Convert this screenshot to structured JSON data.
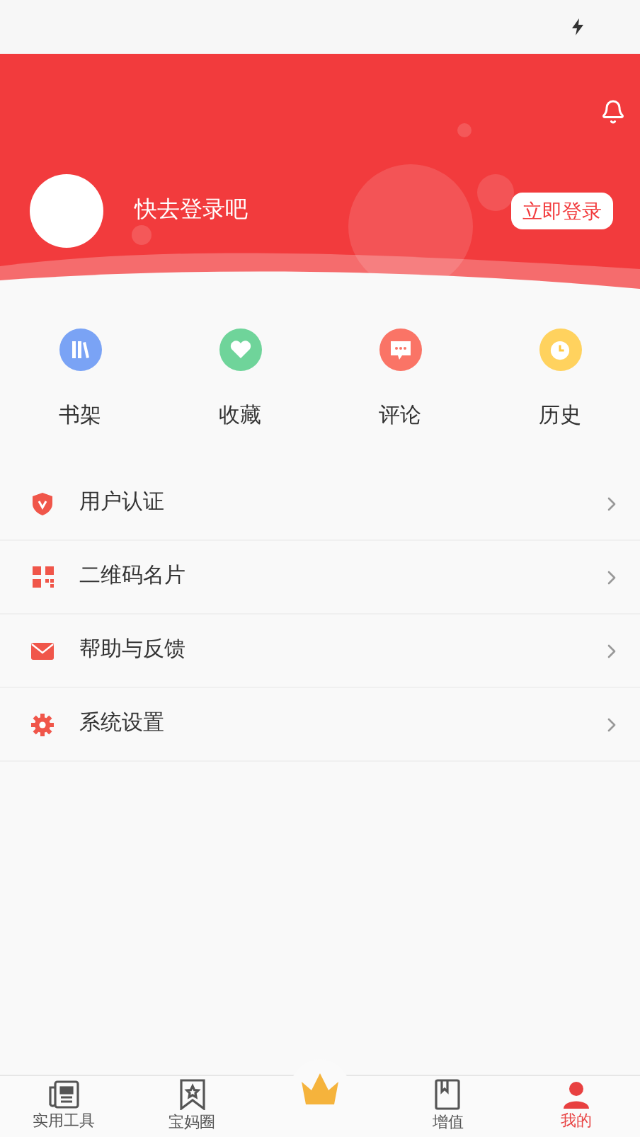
{
  "header": {
    "login_prompt": "快去登录吧",
    "login_button": "立即登录"
  },
  "shortcuts": [
    {
      "label": "书架",
      "kind": "books",
      "color": "#7aa3f5"
    },
    {
      "label": "收藏",
      "kind": "heart",
      "color": "#6fd49a"
    },
    {
      "label": "评论",
      "kind": "comment",
      "color": "#fa7466"
    },
    {
      "label": "历史",
      "kind": "clock",
      "color": "#ffd25e"
    }
  ],
  "menu": [
    {
      "label": "用户认证",
      "kind": "shield"
    },
    {
      "label": "二维码名片",
      "kind": "qr"
    },
    {
      "label": "帮助与反馈",
      "kind": "mail"
    },
    {
      "label": "系统设置",
      "kind": "gear"
    }
  ],
  "bottom_nav": [
    {
      "label": "实用工具",
      "kind": "tools",
      "selected": false
    },
    {
      "label": "宝妈圈",
      "kind": "bookmark",
      "selected": false
    },
    {
      "kind": "crown",
      "selected": false
    },
    {
      "label": "增值",
      "kind": "book",
      "selected": false
    },
    {
      "label": "我的",
      "kind": "user",
      "selected": true
    }
  ]
}
